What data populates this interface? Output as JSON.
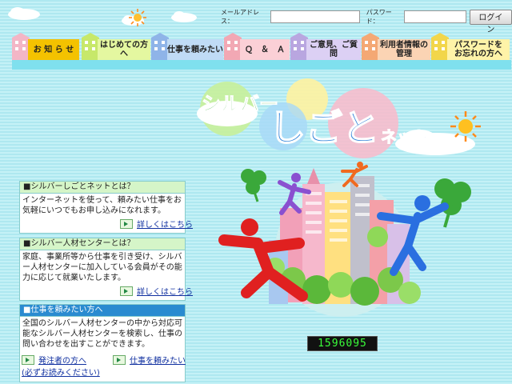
{
  "login": {
    "email_label": "メールアドレス：",
    "password_label": "パスワード：",
    "email_value": "",
    "password_value": "",
    "button_label": "ログイン"
  },
  "nav": {
    "items": [
      {
        "label": "お 知 ら せ"
      },
      {
        "label": "はじめての方へ"
      },
      {
        "label": "仕事を頼みたい"
      },
      {
        "label": "Ｑ　＆　Ａ"
      },
      {
        "label": "ご意見、ご質問"
      },
      {
        "label": "利用者情報の\n管理"
      },
      {
        "label": "パスワードを\nお忘れの方へ"
      }
    ]
  },
  "logo": {
    "line1": "シルバー",
    "line2": "しごと",
    "line3": "ネット"
  },
  "boxes": {
    "about_net": {
      "title": "■シルバーしごとネットとは？",
      "body": "インターネットを使って、頼みたい仕事をお気軽にいつでもお申し込みになれます。",
      "link": "詳しくはこちら"
    },
    "about_center": {
      "title": "■シルバー人材センターとは？",
      "body": "家庭、事業所等から仕事を引き受け、シルバー人材センターに加入している会員がその能力に応じて就業いたします。",
      "link": "詳しくはこちら"
    },
    "request_work": {
      "title": "■仕事を頼みたい方へ",
      "body": "全国のシルバー人材センターの中から対応可能なシルバー人材センターを検索し、仕事の問い合わせを出すことができます。",
      "link1": "発注者の方へ",
      "link1_sub": "(必ずお読みください)",
      "link2": "仕事を頼みたい"
    }
  },
  "counter": {
    "value": "1596095"
  },
  "colors": {
    "bg": "#b5ecf3",
    "nav_strip": "#7fe0ee",
    "header_green": "#d5f5c8",
    "header_blue": "#2a8bd0"
  }
}
